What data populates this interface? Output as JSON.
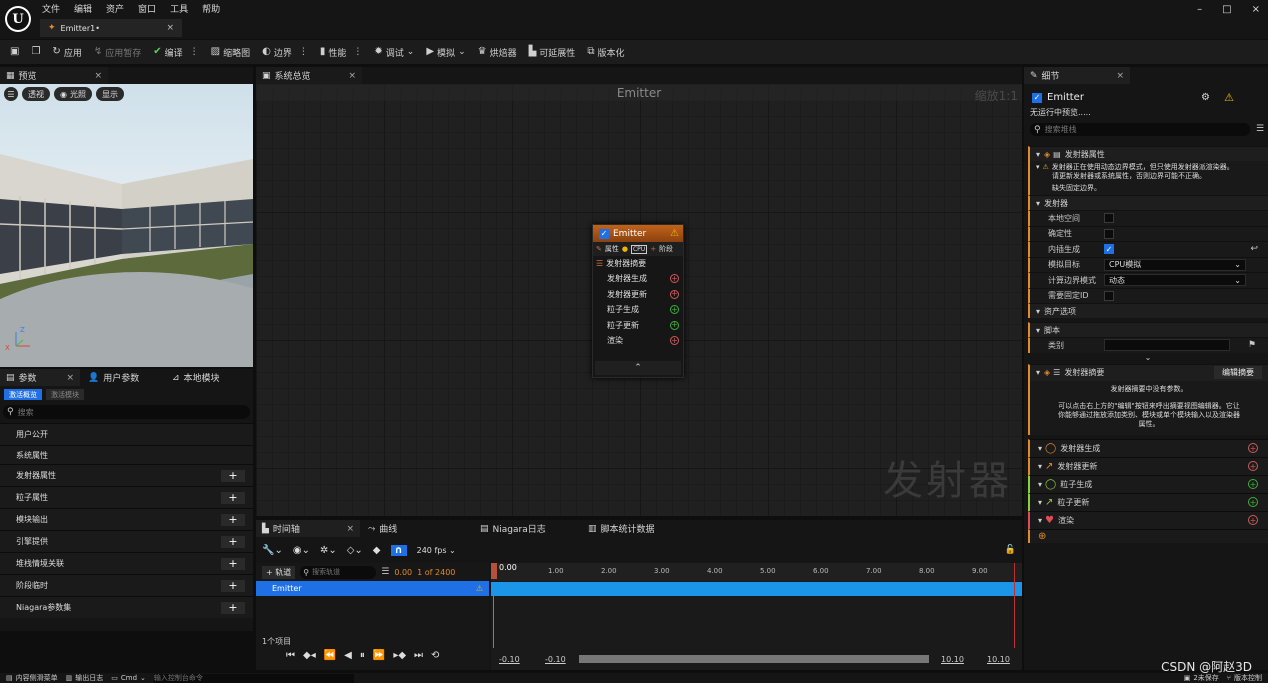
{
  "menu": {
    "items": [
      "文件",
      "编辑",
      "资产",
      "窗口",
      "工具",
      "帮助"
    ],
    "asset_tab": "Emitter1•",
    "window_controls": [
      "–",
      "□",
      "×"
    ]
  },
  "toolbar": {
    "apply": "应用",
    "apply_cache": "应用暂存",
    "compile": "编译",
    "thumbnail": "缩略图",
    "bounds": "边界",
    "performance": "性能",
    "debug": "调试",
    "simulate": "模拟",
    "baker": "烘焙器",
    "scalability": "可延展性",
    "versioning": "版本化"
  },
  "preview": {
    "tab": "预览",
    "perspective": "透视",
    "lit": "光照",
    "show": "显示"
  },
  "params": {
    "tab_params": "参数",
    "tab_user": "用户参数",
    "tab_local": "本地模块",
    "filter_active": "激活概览",
    "filter_modules": "激活模块",
    "search_placeholder": "搜索",
    "rows": [
      "用户公开",
      "系统属性",
      "发射器属性",
      "粒子属性",
      "模块输出",
      "引擎提供",
      "堆栈情境关联",
      "阶段临时",
      "Niagara参数集"
    ],
    "rows_with_add": [
      false,
      false,
      true,
      true,
      true,
      true,
      true,
      true,
      true
    ]
  },
  "system_overview": {
    "tab": "系统总览",
    "graph_title": "Emitter",
    "zoom": "缩放1:1",
    "watermark": "发射器"
  },
  "node": {
    "title": "Emitter",
    "props": "属性",
    "cpu": "CPU",
    "stage": "阶段",
    "summary": "发射器摘要",
    "rows": [
      "发射器生成",
      "发射器更新",
      "粒子生成",
      "粒子更新",
      "渲染"
    ],
    "rows_green": [
      false,
      false,
      true,
      true,
      false
    ]
  },
  "timeline": {
    "tab_timeline": "时间轴",
    "tab_curves": "曲线",
    "tab_log": "Niagara日志",
    "tab_stats": "脚本统计数据",
    "fps": "240 fps",
    "add_track": "+ 轨道",
    "search_track": "搜索轨道",
    "current_time": "0.00",
    "frame_of": "1 of 2400",
    "track_name": "Emitter",
    "item_count": "1个项目",
    "playhead": "0.00",
    "ruler": [
      "1.00",
      "2.00",
      "3.00",
      "4.00",
      "5.00",
      "6.00",
      "7.00",
      "8.00",
      "9.00"
    ],
    "range_start_a": "-0.10",
    "range_start_b": "-0.10",
    "range_end_a": "10.10",
    "range_end_b": "10.10"
  },
  "details": {
    "tab": "细节",
    "emitter_label": "Emitter",
    "not_running": "无运行中预览.....",
    "search_placeholder": "搜索堆栈",
    "emitter_props": "发射器属性",
    "warning_line1": "发射器正在使用动态边界模式，但只使用发射器派渲染器。",
    "warning_line2": "请更新发射器或系统属性，否则边界可能不正确。",
    "missing_bounds": "缺失固定边界。",
    "section_emitter": "发射器",
    "local_space": "本地空间",
    "determinism": "确定性",
    "inherit_spawn": "内插生成",
    "sim_target": "模拟目标",
    "sim_target_value": "CPU模拟",
    "bounds_mode": "计算边界模式",
    "bounds_mode_value": "动态",
    "requires_id": "需要固定ID",
    "section_asset": "资产选项",
    "section_script": "脚本",
    "category": "类别",
    "summary_title": "发射器摘要",
    "edit_summary": "编辑摘要",
    "summary_empty": "发射器摘要中没有参数。",
    "summary_help1": "可以点击右上方的\"编辑\"按钮来呼出摘要视图编辑器。它让",
    "summary_help2": "你能够通过拖放添加类别、模块或单个模块输入以及渲染器",
    "summary_help3": "属性。",
    "stack": [
      "发射器生成",
      "发射器更新",
      "粒子生成",
      "粒子更新",
      "渲染"
    ],
    "stack_green": [
      false,
      false,
      true,
      true,
      false
    ],
    "stack_colors": [
      "#e08a2a",
      "#e08a2a",
      "#8ad03a",
      "#8ad03a",
      "#e04a5a"
    ]
  },
  "statusbar": {
    "content_drawer": "内容侧滑菜单",
    "output_log": "输出日志",
    "cmd": "Cmd",
    "cmd_placeholder": "输入控制台命令",
    "unsaved": "2未保存",
    "revision": "版本控制",
    "watermark": "CSDN @阿赵3D"
  },
  "colors": {
    "accent_blue": "#1f6fe5",
    "track_blue": "#1a95e8",
    "node_header": "#b55a17",
    "warning": "#f0b400",
    "green": "#3ab03a",
    "red": "#d05a5a"
  }
}
